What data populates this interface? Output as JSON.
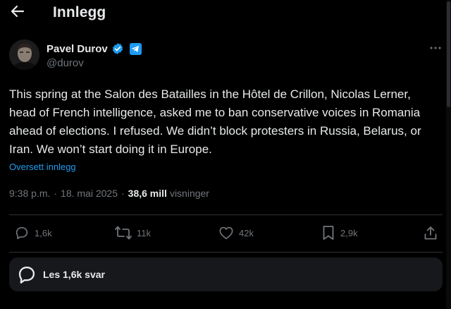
{
  "header": {
    "title": "Innlegg",
    "back_icon": "arrow-left-icon"
  },
  "post": {
    "author_name": "Pavel Durov",
    "handle": "@durov",
    "verified_color": "#1d9bf0",
    "badges": [
      "verified-badge-icon",
      "telegram-icon"
    ],
    "text": "This spring at the Salon des Batailles in the Hôtel de Crillon, Nicolas Lerner, head of French intelligence, asked me to ban conservative voices in Romania ahead of elections. I refused. We didn’t block protesters in Russia, Belarus, or Iran. We won’t start doing it in Europe.",
    "translate_label": "Oversett innlegg",
    "time": "9:38 p.m.",
    "separator": "·",
    "date": "18. mai 2025",
    "views_count": "38,6 mill",
    "views_label": "visninger"
  },
  "actions": {
    "replies": "1,6k",
    "reposts": "11k",
    "likes": "42k",
    "bookmarks": "2,9k"
  },
  "replies_bar": {
    "label": "Les 1,6k svar"
  },
  "colors": {
    "background": "#000000",
    "text": "#e7e9ea",
    "muted": "#71767b",
    "accent": "#1d9bf0",
    "divider": "#2f3336",
    "panel": "#16181c"
  }
}
